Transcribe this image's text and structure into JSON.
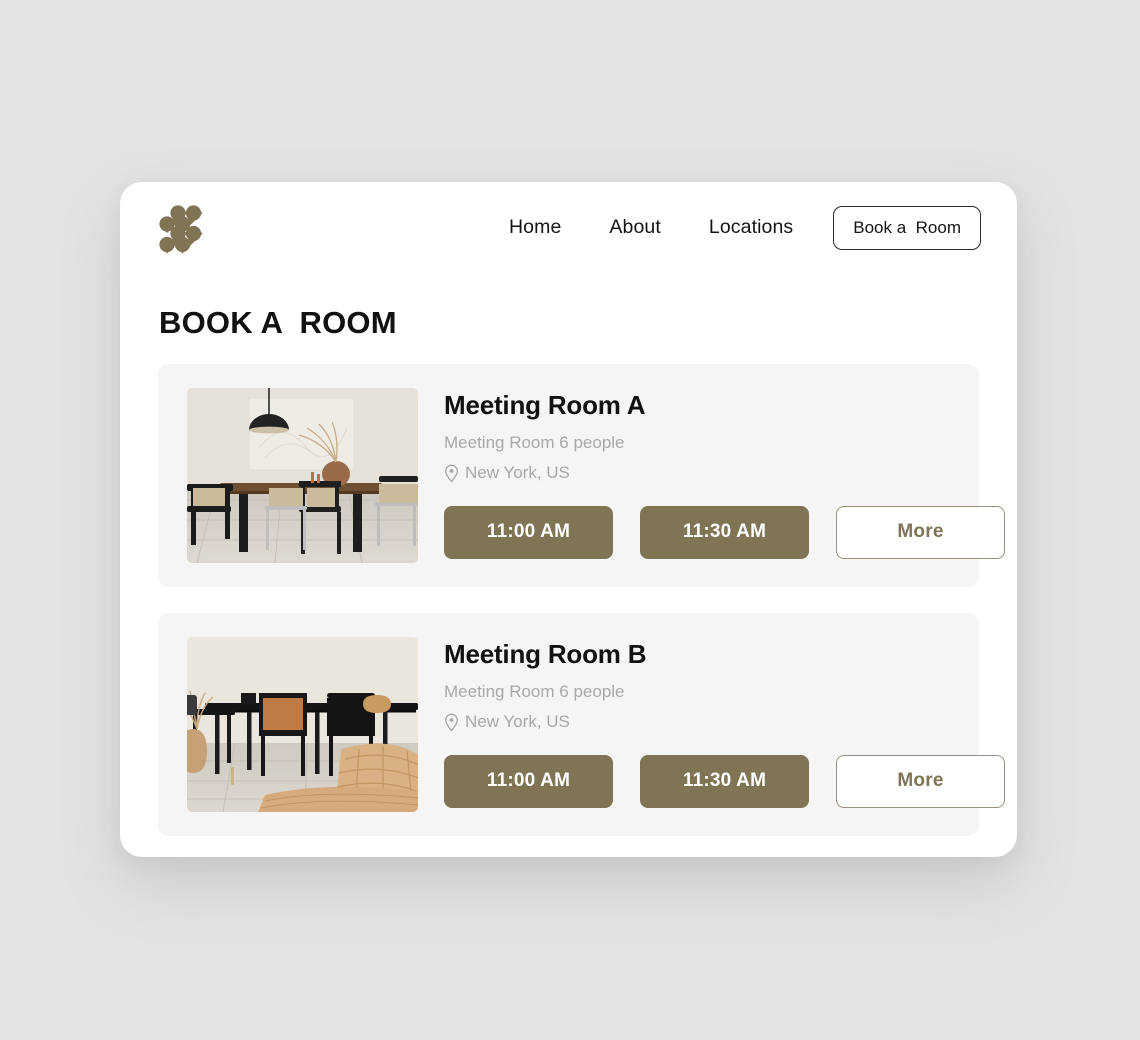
{
  "colors": {
    "page_background": "#e3e3e3",
    "panel_background": "#ffffff",
    "card_background": "#f5f5f5",
    "accent_olive": "#7f7555",
    "text_primary": "#111111",
    "text_muted": "#a8a8a8"
  },
  "header": {
    "logo_name": "brand-logo",
    "nav": [
      {
        "label": "Home"
      },
      {
        "label": "About"
      },
      {
        "label": "Locations"
      }
    ],
    "cta_label": "Book a  Room"
  },
  "page_title": "BOOK A  ROOM",
  "rooms": [
    {
      "name": "Meeting Room A",
      "meta": "Meeting Room 6 people",
      "location": "New York, US",
      "location_icon": "map-pin-icon",
      "image_alt": "meeting room with black pendant lamp, wooden table and black chairs",
      "slots": [
        {
          "label": "11:00 AM",
          "style": "filled"
        },
        {
          "label": "11:30 AM",
          "style": "filled"
        },
        {
          "label": "More",
          "style": "outline"
        }
      ]
    },
    {
      "name": "Meeting Room B",
      "meta": "Meeting Room 6 people",
      "location": "New York, US",
      "location_icon": "map-pin-icon",
      "image_alt": "long black table with tan leather chair, black chairs and woven rattan decor",
      "slots": [
        {
          "label": "11:00 AM",
          "style": "filled"
        },
        {
          "label": "11:30 AM",
          "style": "filled"
        },
        {
          "label": "More",
          "style": "outline"
        }
      ]
    }
  ]
}
